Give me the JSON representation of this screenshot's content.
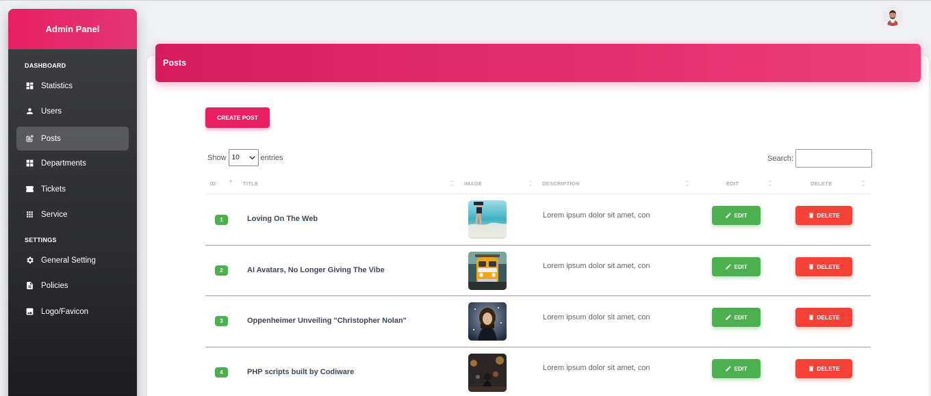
{
  "sidebar": {
    "brand": "Admin Panel",
    "sections": [
      "DASHBOARD",
      "SETTINGS"
    ],
    "items": [
      {
        "label": "Statistics",
        "icon": "dashboard-icon",
        "active": false
      },
      {
        "label": "Users",
        "icon": "person-icon",
        "active": false
      },
      {
        "label": "Posts",
        "icon": "post-add-icon",
        "active": true
      },
      {
        "label": "Departments",
        "icon": "grid-icon",
        "active": false
      },
      {
        "label": "Tickets",
        "icon": "ticket-icon",
        "active": false
      },
      {
        "label": "Service",
        "icon": "apps-icon",
        "active": false
      },
      {
        "label": "General Setting",
        "icon": "gear-icon",
        "active": false
      },
      {
        "label": "Policies",
        "icon": "document-icon",
        "active": false
      },
      {
        "label": "Logo/Favicon",
        "icon": "image-icon",
        "active": false
      }
    ]
  },
  "header": {
    "title": "Posts"
  },
  "toolbar": {
    "create_label": "CREATE POST",
    "show_label": "Show",
    "entries_value": "10",
    "entries_label": "entries",
    "search_label": "Search:",
    "search_value": ""
  },
  "table": {
    "columns": [
      "ID",
      "TITLE",
      "IMAGE",
      "DESCRIPTION",
      "EDIT",
      "DELETE"
    ],
    "edit_label": "EDIT",
    "delete_label": "DELETE",
    "rows": [
      {
        "id": "1",
        "title": "Loving On The Web",
        "description": "Lorem ipsum dolor sit amet, con",
        "image": "beach-photo"
      },
      {
        "id": "2",
        "title": "AI Avatars, No Longer Giving The Vibe",
        "description": "Lorem ipsum dolor sit amet, con",
        "image": "van-photo"
      },
      {
        "id": "3",
        "title": "Oppenheimer Unveiling \"Christopher Nolan\"",
        "description": "Lorem ipsum dolor sit amet, con",
        "image": "winter-portrait-photo"
      },
      {
        "id": "4",
        "title": "PHP scripts built by Codiware",
        "description": "Lorem ipsum dolor sit amet, con",
        "image": "city-night-photo"
      }
    ]
  },
  "colors": {
    "primary": "#e91e63",
    "success": "#4caf50",
    "danger": "#f44336",
    "sidebar_bg": "#2c2d31"
  }
}
